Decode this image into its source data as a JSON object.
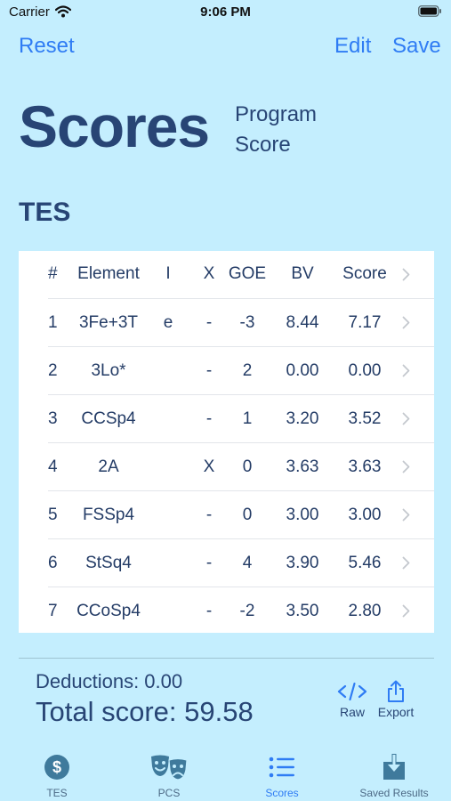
{
  "status": {
    "carrier": "Carrier",
    "time": "9:06 PM"
  },
  "nav": {
    "reset": "Reset",
    "edit": "Edit",
    "save": "Save"
  },
  "title": {
    "main": "Scores",
    "sub_line1": "Program",
    "sub_line2": "Score"
  },
  "section": "TES",
  "table": {
    "headers": {
      "num": "#",
      "element": "Element",
      "i": "I",
      "x": "X",
      "goe": "GOE",
      "bv": "BV",
      "score": "Score"
    },
    "rows": [
      {
        "num": "1",
        "element": "3Fe+3T",
        "i": "e",
        "x": "-",
        "goe": "-3",
        "bv": "8.44",
        "score": "7.17"
      },
      {
        "num": "2",
        "element": "3Lo*",
        "i": "",
        "x": "-",
        "goe": "2",
        "bv": "0.00",
        "score": "0.00"
      },
      {
        "num": "3",
        "element": "CCSp4",
        "i": "",
        "x": "-",
        "goe": "1",
        "bv": "3.20",
        "score": "3.52"
      },
      {
        "num": "4",
        "element": "2A",
        "i": "",
        "x": "X",
        "goe": "0",
        "bv": "3.63",
        "score": "3.63"
      },
      {
        "num": "5",
        "element": "FSSp4",
        "i": "",
        "x": "-",
        "goe": "0",
        "bv": "3.00",
        "score": "3.00"
      },
      {
        "num": "6",
        "element": "StSq4",
        "i": "",
        "x": "-",
        "goe": "4",
        "bv": "3.90",
        "score": "5.46"
      },
      {
        "num": "7",
        "element": "CCoSp4",
        "i": "",
        "x": "-",
        "goe": "-2",
        "bv": "3.50",
        "score": "2.80"
      }
    ]
  },
  "summary": {
    "deductions": "Deductions: 0.00",
    "total": "Total score: 59.58"
  },
  "actions": {
    "raw": "Raw",
    "export": "Export"
  },
  "tabs": {
    "tes": "TES",
    "pcs": "PCS",
    "scores": "Scores",
    "saved": "Saved Results"
  },
  "colors": {
    "background": "#c4eefe",
    "accent": "#2f7cf4",
    "title": "#284575",
    "tab_icon": "#3f7a9c"
  },
  "icons": {
    "wifi": "wifi-icon",
    "battery": "battery-icon",
    "chevron": "chevron-right-icon",
    "raw": "code-icon",
    "export": "share-icon",
    "tes": "dollar-circle-icon",
    "pcs": "theater-masks-icon",
    "scores": "list-bullet-icon",
    "saved": "download-tray-icon"
  }
}
